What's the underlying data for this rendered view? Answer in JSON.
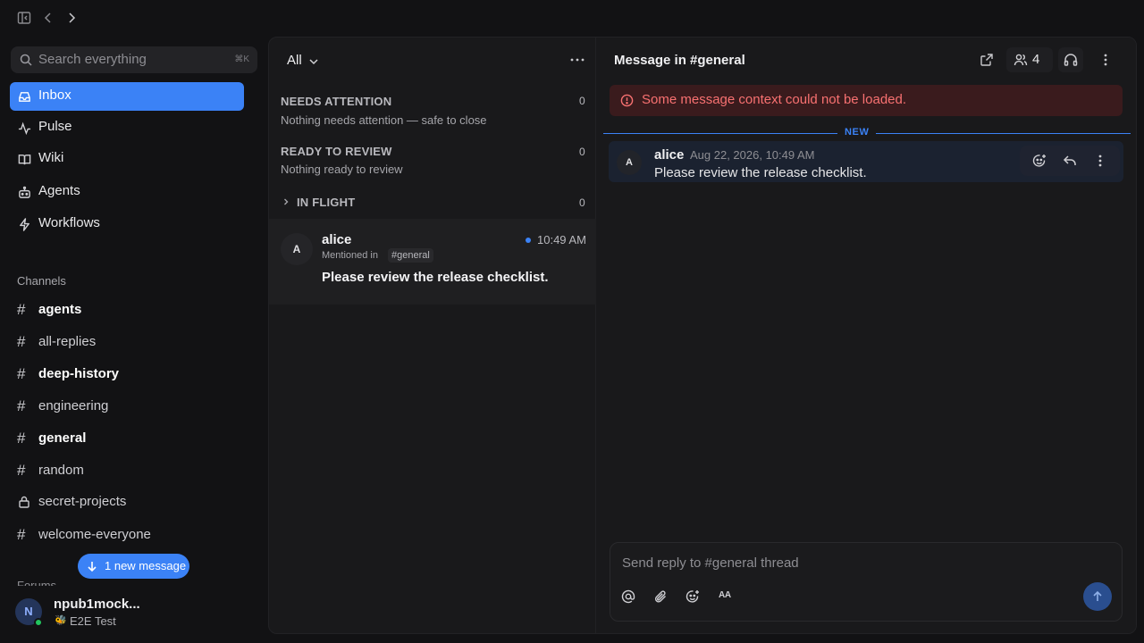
{
  "sidebar": {
    "search": {
      "placeholder": "Search everything",
      "shortcut": "⌘K"
    },
    "nav": [
      {
        "label": "Inbox",
        "icon": "inbox-icon",
        "active": true
      },
      {
        "label": "Pulse",
        "icon": "pulse-icon"
      },
      {
        "label": "Wiki",
        "icon": "book-icon"
      },
      {
        "label": "Agents",
        "icon": "bot-icon"
      },
      {
        "label": "Workflows",
        "icon": "bolt-icon"
      }
    ],
    "channels_title": "Channels",
    "channels": [
      {
        "label": "agents",
        "unread": true
      },
      {
        "label": "all-replies",
        "unread": false
      },
      {
        "label": "deep-history",
        "unread": true
      },
      {
        "label": "engineering",
        "unread": false
      },
      {
        "label": "general",
        "unread": true
      },
      {
        "label": "random",
        "unread": false
      },
      {
        "label": "secret-projects",
        "private": true,
        "unread": false
      },
      {
        "label": "welcome-everyone",
        "unread": false
      }
    ],
    "new_message_pill": "1 new message",
    "forums_title": "Forums",
    "user": {
      "initial": "N",
      "name": "npub1mock...",
      "status_emoji": "🐝",
      "status": "E2E Test"
    }
  },
  "inbox": {
    "filter": "All",
    "groups": [
      {
        "title": "NEEDS ATTENTION",
        "count": "0",
        "empty": "Nothing needs attention — safe to close"
      },
      {
        "title": "READY TO REVIEW",
        "count": "0",
        "empty": "Nothing ready to review"
      },
      {
        "title": "IN FLIGHT",
        "count": "0"
      }
    ],
    "items": [
      {
        "avatar": "A",
        "name": "alice",
        "time": "10:49 AM",
        "meta": "Mentioned in",
        "channel": "#general",
        "text": "Please review the release checklist."
      }
    ]
  },
  "detail": {
    "title": "Message in #general",
    "members_count": "4",
    "error": "Some message context could not be loaded.",
    "new_divider": "NEW",
    "message": {
      "avatar": "A",
      "author": "alice",
      "timestamp": "Aug 22, 2026, 10:49 AM",
      "text": "Please review the release checklist."
    },
    "composer": {
      "placeholder": "Send reply to #general thread",
      "format_label": "AA"
    }
  },
  "colors": {
    "accent": "#3b82f6",
    "error": "#f87171",
    "presence": "#22c55e"
  }
}
